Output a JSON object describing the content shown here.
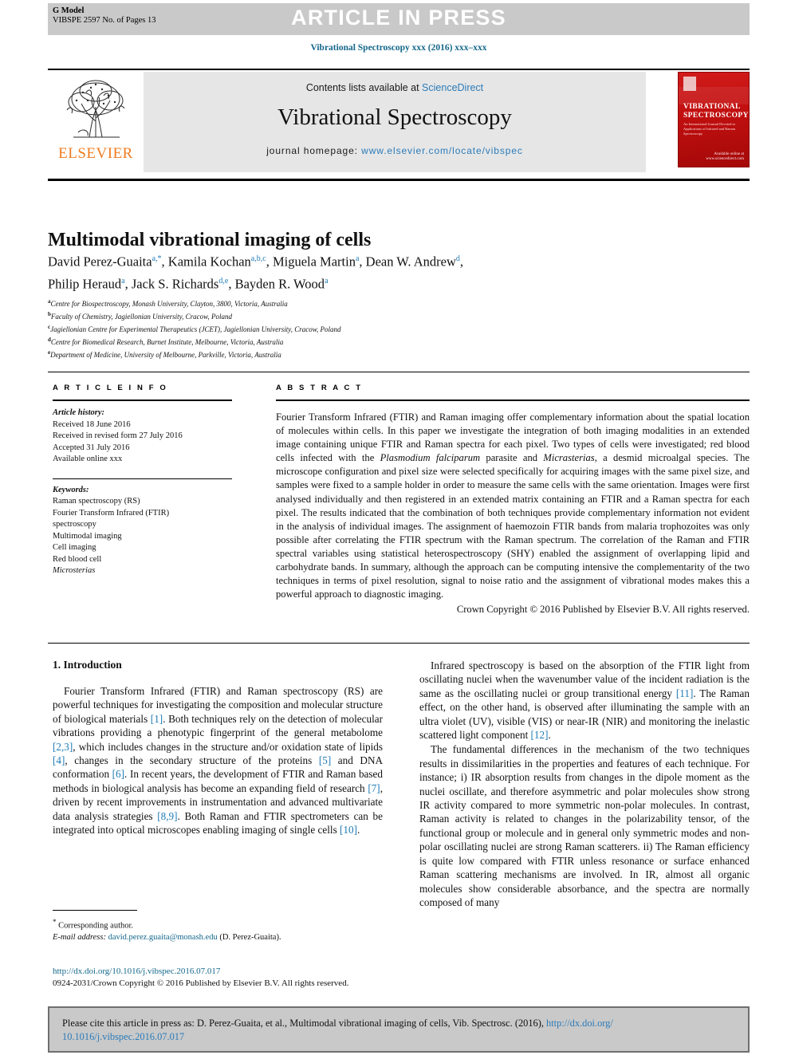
{
  "banner": {
    "gmodel_label": "G Model",
    "gmodel_sub": "VIBSPE 2597 No. of Pages 13",
    "article_in_press": "ARTICLE IN PRESS"
  },
  "journal_line": "Vibrational Spectroscopy xxx (2016) xxx–xxx",
  "masthead": {
    "contents_prefix": "Contents lists available at ",
    "contents_link": "ScienceDirect",
    "journal_title": "Vibrational Spectroscopy",
    "homepage_prefix": "journal homepage: ",
    "homepage_link": "www.elsevier.com/locate/vibspec",
    "publisher": "ELSEVIER",
    "cover_title_line1": "VIBRATIONAL",
    "cover_title_line2": "SPECTROSCOPY",
    "cover_sub": "An International Journal Devoted to Applications of Infrared and Raman Spectroscopy",
    "cover_footer": "Available online at www.sciencedirect.com"
  },
  "article": {
    "title": "Multimodal vibrational imaging of cells",
    "authors_line1_parts": [
      {
        "name": "David Perez-Guaita",
        "sup": "a,*"
      },
      {
        "name": "Kamila Kochan",
        "sup": "a,b,c"
      },
      {
        "name": "Miguela Martin",
        "sup": "a"
      },
      {
        "name": "Dean W. Andrew",
        "sup": "d"
      }
    ],
    "authors_line2_parts": [
      {
        "name": "Philip Heraud",
        "sup": "a"
      },
      {
        "name": "Jack S. Richards",
        "sup": "d,e"
      },
      {
        "name": "Bayden R. Wood",
        "sup": "a"
      }
    ],
    "affiliations": [
      {
        "marker": "a",
        "text": "Centre for Biospectroscopy, Monash University, Clayton, 3800, Victoria, Australia"
      },
      {
        "marker": "b",
        "text": "Faculty of Chemistry, Jagiellonian University, Cracow, Poland"
      },
      {
        "marker": "c",
        "text": "Jagiellonian Centre for Experimental Therapeutics (JCET), Jagiellonian University, Cracow, Poland"
      },
      {
        "marker": "d",
        "text": "Centre for Biomedical Research, Burnet Institute, Melbourne, Victoria, Australia"
      },
      {
        "marker": "e",
        "text": "Department of Medicine, University of Melbourne, Parkville, Victoria, Australia"
      }
    ]
  },
  "article_info": {
    "heading": "A R T I C L E   I N F O",
    "history_label": "Article history:",
    "history": [
      "Received 18 June 2016",
      "Received in revised form 27 July 2016",
      "Accepted 31 July 2016",
      "Available online xxx"
    ],
    "keywords_label": "Keywords:",
    "keywords": [
      "Raman spectroscopy (RS)",
      "Fourier Transform Infrared (FTIR)",
      "spectroscopy",
      "Multimodal imaging",
      "Cell imaging",
      "Red blood cell"
    ],
    "keyword_italic": "Microsterias"
  },
  "abstract": {
    "heading": "A B S T R A C T",
    "p1_a": "Fourier Transform Infrared (FTIR) and Raman imaging offer complementary information about the spatial location of molecules within cells. In this paper we investigate the integration of both imaging modalities in an extended image containing unique FTIR and Raman spectra for each pixel. Two types of cells were investigated; red blood cells infected with the ",
    "p1_i1": "Plasmodium falciparum",
    "p1_b": " parasite and ",
    "p1_i2": "Micrasterias",
    "p1_c": ", a desmid microalgal species. The microscope configuration and pixel size were selected specifically for acquiring images with the same pixel size, and samples were fixed to a sample holder in order to measure the same cells with the same orientation. Images were first analysed individually and then registered in an extended matrix containing an FTIR and a Raman spectra for each pixel. The results indicated that the combination of both techniques provide complementary information not evident in the analysis of individual images. The assignment of haemozoin FTIR bands from malaria trophozoites was only possible after correlating the FTIR spectrum with the Raman spectrum. The correlation of the Raman and FTIR spectral variables using statistical heterospectroscopy (SHY) enabled the assignment of overlapping lipid and carbohydrate bands. In summary, although the approach can be computing intensive the complementarity of the two techniques in terms of pixel resolution, signal to noise ratio and the assignment of vibrational modes makes this a powerful approach to diagnostic imaging.",
    "copyright": "Crown Copyright © 2016 Published by Elsevier B.V. All rights reserved."
  },
  "body": {
    "section_heading": "1. Introduction",
    "left_p1_a": "Fourier Transform Infrared (FTIR) and Raman spectroscopy (RS) are powerful techniques for investigating the composition and molecular structure of biological materials ",
    "left_p1_r1": "[1]",
    "left_p1_b": ". Both techniques rely on the detection of molecular vibrations providing a phenotypic fingerprint of the general metabolome ",
    "left_p1_r2": "[2,3]",
    "left_p1_c": ", which includes changes in the structure and/or oxidation state of lipids ",
    "left_p1_r3": "[4]",
    "left_p1_d": ", changes in the secondary structure of the proteins ",
    "left_p1_r4": "[5]",
    "left_p1_e": " and DNA conformation ",
    "left_p1_r5": "[6]",
    "left_p1_f": ". In recent years, the development of FTIR and Raman based methods in biological analysis has become an expanding field of research ",
    "left_p1_r6": "[7]",
    "left_p1_g": ", driven by recent improvements in instrumentation and advanced multivariate data analysis strategies ",
    "left_p1_r7": "[8,9]",
    "left_p1_h": ". Both Raman and FTIR spectrometers can be integrated into optical microscopes enabling imaging of single cells ",
    "left_p1_r8": "[10]",
    "left_p1_i": ".",
    "right_p1_a": "Infrared spectroscopy is based on the absorption of the FTIR light from oscillating nuclei when the wavenumber value of the incident radiation is the same as the oscillating nuclei or group transitional energy ",
    "right_p1_r1": "[11]",
    "right_p1_b": ". The Raman effect, on the other hand, is observed after illuminating the sample with an ultra violet (UV), visible (VIS) or near-IR (NIR) and monitoring the inelastic scattered light component ",
    "right_p1_r2": "[12]",
    "right_p1_c": ".",
    "right_p2": "The fundamental differences in the mechanism of the two techniques results in dissimilarities in the properties and features of each technique. For instance; i) IR absorption results from changes in the dipole moment as the nuclei oscillate, and therefore asymmetric and polar molecules show strong IR activity compared to more symmetric non-polar molecules. In contrast, Raman activity is related to changes in the polarizability tensor, of the functional group or molecule and in general only symmetric modes and non-polar oscillating nuclei are strong Raman scatterers. ii) The Raman efficiency is quite low compared with FTIR unless resonance or surface enhanced Raman scattering mechanisms are involved. In IR, almost all organic molecules show considerable absorbance, and the spectra are normally composed of many"
  },
  "footer": {
    "corresponding_author": "Corresponding author.",
    "email_label": "E-mail address:",
    "email": "david.perez.guaita@monash.edu",
    "email_attrib": "(D. Perez-Guaita).",
    "doi_url": "http://dx.doi.org/10.1016/j.vibspec.2016.07.017",
    "issn_line": "0924-2031/Crown Copyright © 2016 Published by Elsevier B.V. All rights reserved."
  },
  "cite_box": {
    "text": "Please cite this article in press as: D. Perez-Guaita, et al., Multimodal vibrational imaging of cells, Vib. Spectrosc. (2016), ",
    "link1": "http://dx.doi.org/",
    "link2": "10.1016/j.vibspec.2016.07.017"
  },
  "colors": {
    "link_blue": "#2b7bb9",
    "header_blue": "#14678b",
    "ref_blue": "#1f7bb6",
    "banner_gray": "#c9c9c9",
    "masthead_gray": "#e6e6e6",
    "elsevier_orange": "#ef7c20",
    "cover_red": "#c00f0f"
  }
}
